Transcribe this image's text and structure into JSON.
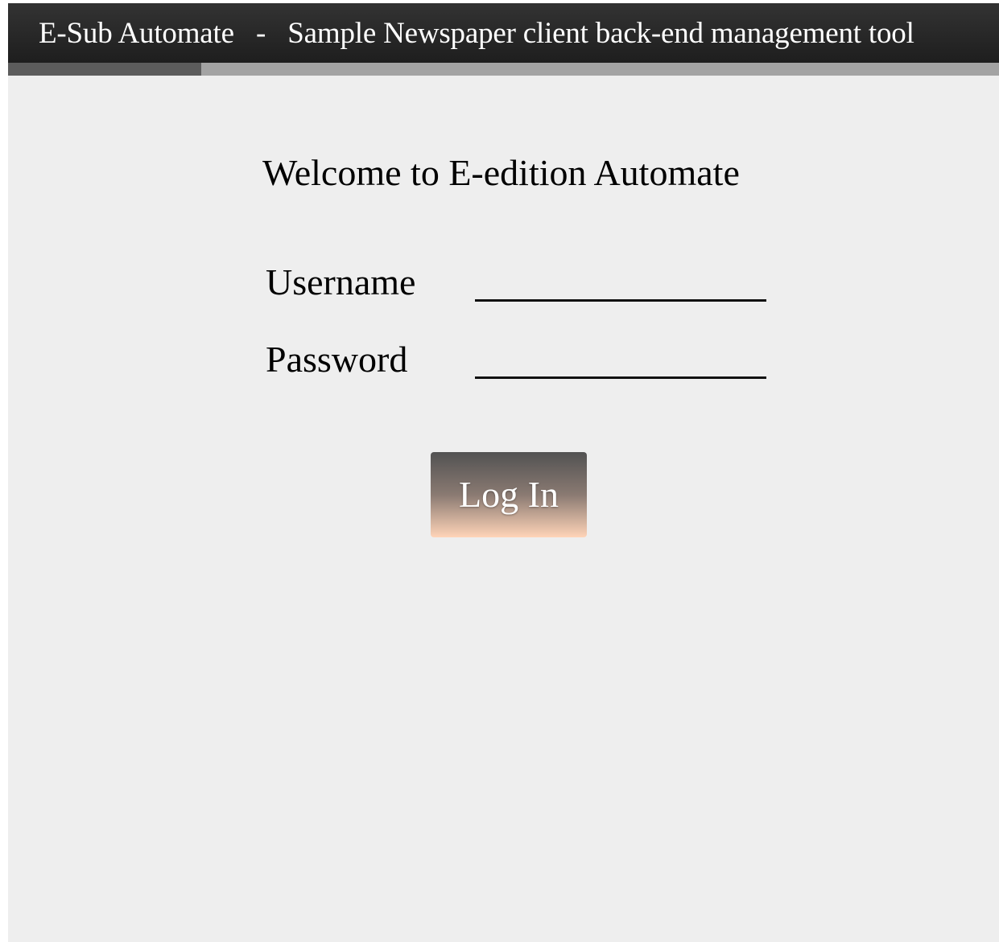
{
  "header": {
    "app_name": "E-Sub Automate",
    "separator": "-",
    "subtitle": "Sample Newspaper client back-end management tool"
  },
  "login": {
    "welcome": "Welcome to E-edition Automate",
    "username_label": "Username",
    "username_value": "",
    "password_label": "Password",
    "password_value": "",
    "submit_label": "Log In"
  },
  "colors": {
    "header_background": "#262626",
    "page_background": "#eeeeee",
    "tab_active": "#5c5c5c",
    "tab_track": "#a3a3a3",
    "button_gradient_top": "#525252",
    "button_gradient_bottom": "#ffd4b8"
  }
}
